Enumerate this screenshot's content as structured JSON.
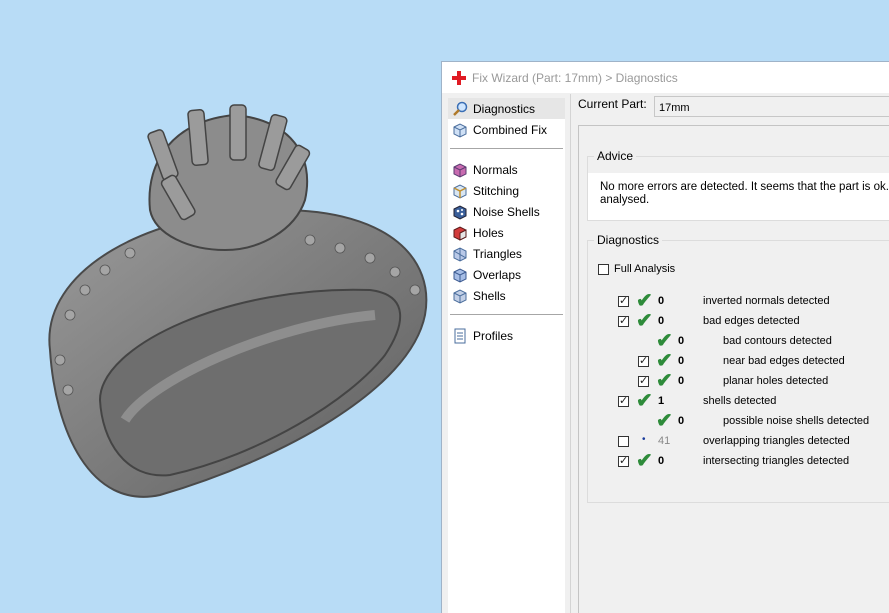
{
  "window": {
    "title": "Fix Wizard (Part: 17mm) > Diagnostics"
  },
  "sidebar": {
    "group1": [
      {
        "label": "Diagnostics",
        "icon": "magnifier-icon",
        "selected": true
      },
      {
        "label": "Combined Fix",
        "icon": "combined-fix-icon"
      }
    ],
    "group2": [
      {
        "label": "Normals",
        "icon": "normals-icon"
      },
      {
        "label": "Stitching",
        "icon": "stitching-icon"
      },
      {
        "label": "Noise Shells",
        "icon": "noise-shells-icon"
      },
      {
        "label": "Holes",
        "icon": "holes-icon"
      },
      {
        "label": "Triangles",
        "icon": "triangles-icon"
      },
      {
        "label": "Overlaps",
        "icon": "overlaps-icon"
      },
      {
        "label": "Shells",
        "icon": "shells-icon"
      }
    ],
    "group3": [
      {
        "label": "Profiles",
        "icon": "profiles-icon"
      }
    ]
  },
  "current_part": {
    "label": "Current Part:",
    "value": "17mm"
  },
  "advice": {
    "title": "Advice",
    "text": "No more errors are detected. It seems that the part is ok. analysed."
  },
  "diagnostics": {
    "title": "Diagnostics",
    "full_analysis_label": "Full Analysis",
    "rows": [
      {
        "checked": true,
        "status": "ok",
        "count": "0",
        "label": "inverted normals detected"
      },
      {
        "checked": true,
        "status": "ok",
        "count": "0",
        "label": "bad edges detected"
      },
      {
        "checked": null,
        "status": "ok",
        "count": "0",
        "label": "bad contours detected"
      },
      {
        "checked": true,
        "status": "ok",
        "count": "0",
        "label": "near bad edges detected"
      },
      {
        "checked": true,
        "status": "ok",
        "count": "0",
        "label": "planar holes detected"
      },
      {
        "checked": true,
        "status": "ok",
        "count": "1",
        "label": "shells detected"
      },
      {
        "checked": null,
        "status": "ok",
        "count": "0",
        "label": "possible noise shells detected"
      },
      {
        "checked": false,
        "status": "dot",
        "count": "41",
        "label": "overlapping triangles detected"
      },
      {
        "checked": true,
        "status": "ok",
        "count": "0",
        "label": "intersecting triangles detected"
      }
    ]
  },
  "colors": {
    "viewport_bg": "#b8dcf6",
    "ok_tick": "#2e8b3a",
    "ring": "#8a8a8a"
  }
}
